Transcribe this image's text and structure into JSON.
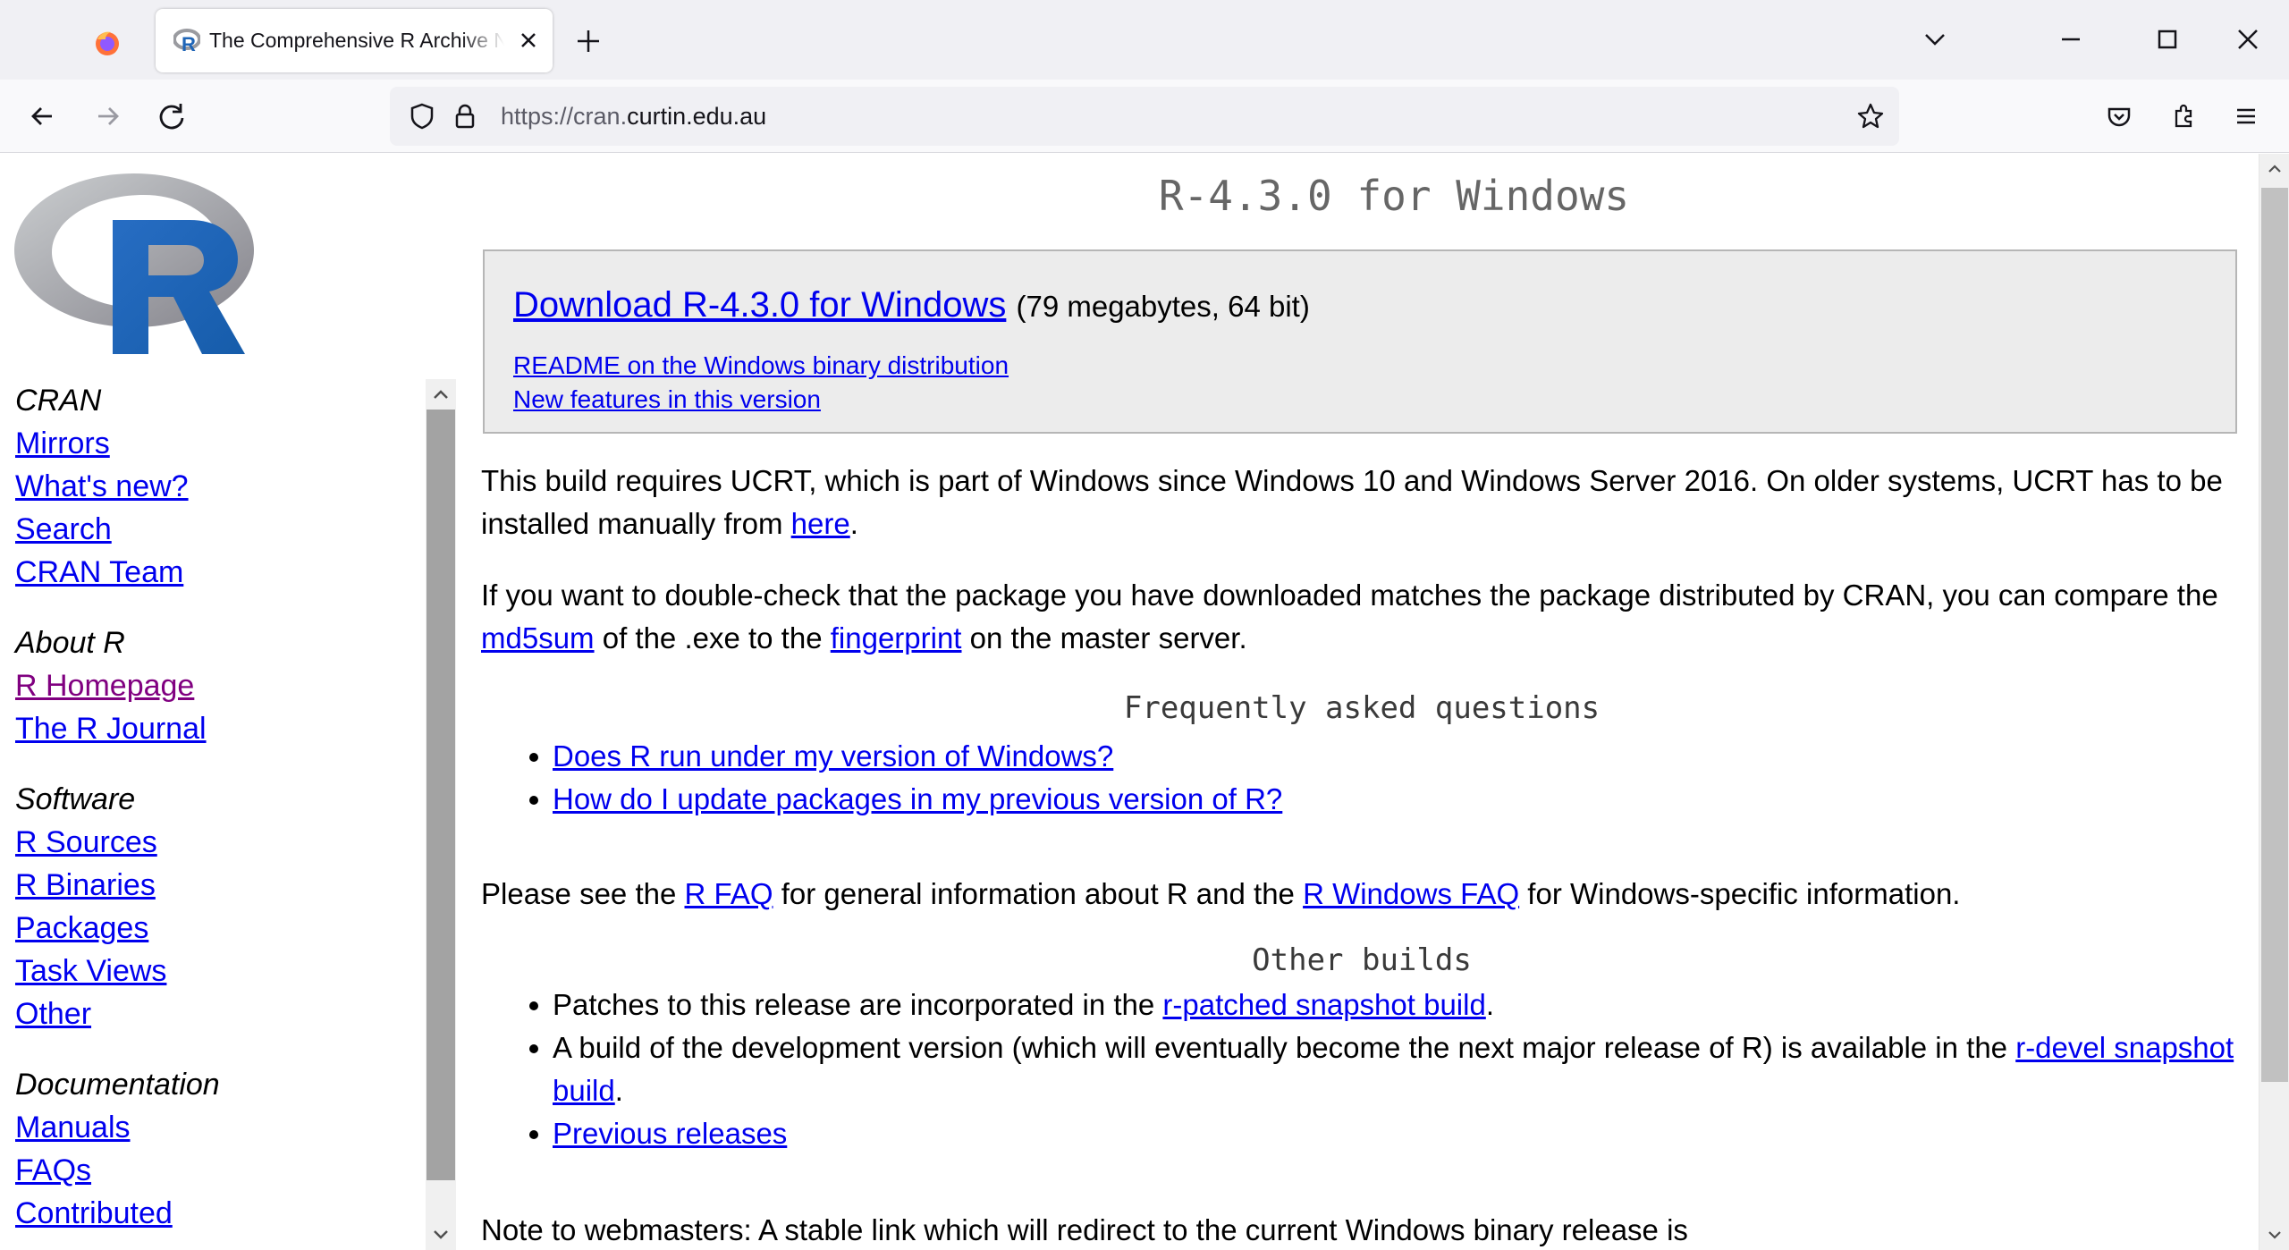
{
  "browser": {
    "tab_title": "The Comprehensive R Archive Network",
    "url_prefix": "https://cran.",
    "url_domain": "curtin.edu.au"
  },
  "sidebar": {
    "sections": [
      {
        "heading": "CRAN",
        "links": [
          {
            "label": "Mirrors"
          },
          {
            "label": "What's new?"
          },
          {
            "label": "Search"
          },
          {
            "label": "CRAN Team"
          }
        ]
      },
      {
        "heading": "About R",
        "links": [
          {
            "label": "R Homepage",
            "visited": true
          },
          {
            "label": "The R Journal"
          }
        ]
      },
      {
        "heading": "Software",
        "links": [
          {
            "label": "R Sources"
          },
          {
            "label": "R Binaries"
          },
          {
            "label": "Packages"
          },
          {
            "label": "Task Views"
          },
          {
            "label": "Other"
          }
        ]
      },
      {
        "heading": "Documentation",
        "links": [
          {
            "label": "Manuals"
          },
          {
            "label": "FAQs"
          },
          {
            "label": "Contributed"
          }
        ]
      }
    ]
  },
  "main": {
    "title": "R-4.3.0 for Windows",
    "download": {
      "link": "Download R-4.3.0 for Windows",
      "size": "(79 megabytes, 64 bit)",
      "readme": "README on the Windows binary distribution",
      "new_features": "New features in this version"
    },
    "ucrt": {
      "text1": "This build requires UCRT, which is part of Windows since Windows 10 and Windows Server 2016. On older systems, UCRT has to be installed manually from ",
      "link": "here",
      "text2": "."
    },
    "check": {
      "text1": "If you want to double-check that the package you have downloaded matches the package distributed by CRAN, you can compare the ",
      "link1": "md5sum",
      "text2": " of the .exe to the ",
      "link2": "fingerprint",
      "text3": " on the master server."
    },
    "faq_heading": "Frequently asked questions",
    "faq_items": [
      "Does R run under my version of Windows?",
      "How do I update packages in my previous version of R?"
    ],
    "faq_note": {
      "text1": "Please see the ",
      "link1": "R FAQ",
      "text2": " for general information about R and the ",
      "link2": "R Windows FAQ",
      "text3": " for Windows-specific information."
    },
    "other_heading": "Other builds",
    "other": {
      "item1_text": "Patches to this release are incorporated in the ",
      "item1_link": "r-patched snapshot build",
      "item1_end": ".",
      "item2_text": "A build of the development version (which will eventually become the next major release of R) is available in the ",
      "item2_link": "r-devel snapshot build",
      "item2_end": ".",
      "item3_link": "Previous releases"
    },
    "webmasters": "Note to webmasters: A stable link which will redirect to the current Windows binary release is"
  }
}
